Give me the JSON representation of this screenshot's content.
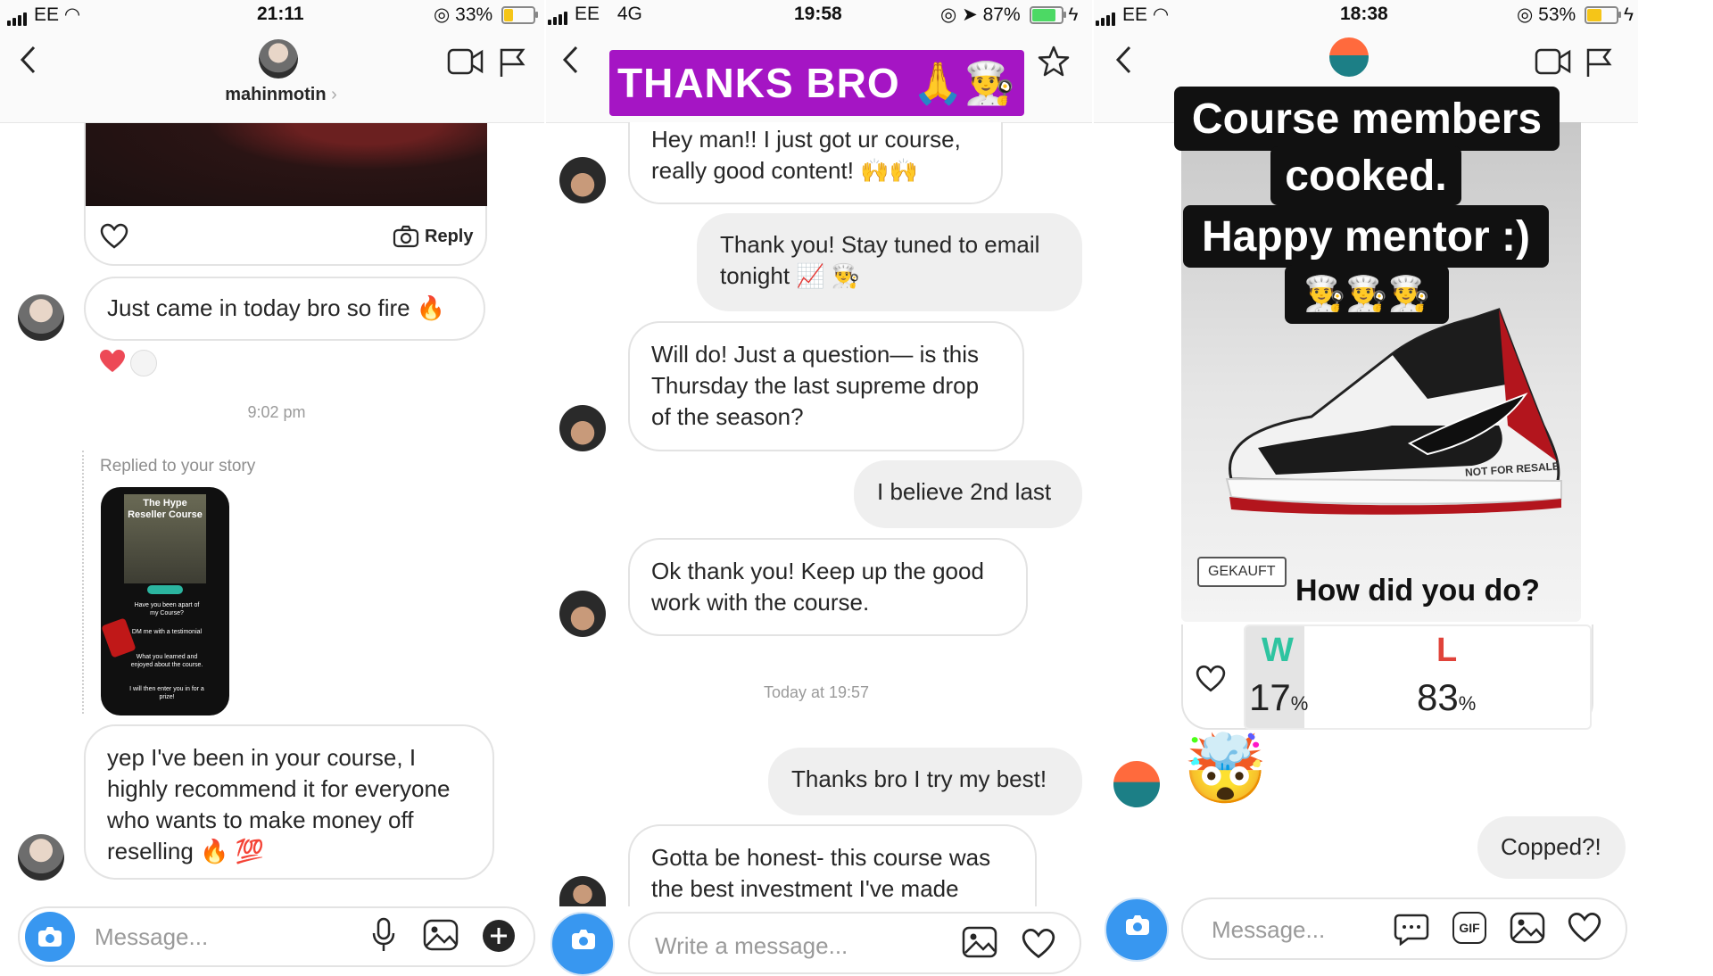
{
  "panel1": {
    "status": {
      "carrier": "EE",
      "time": "21:11",
      "battery": "33%"
    },
    "username": "mahinmotin",
    "story_reply_label": "Reply",
    "msg1": "Just came in today bro so fire 🔥",
    "timestamp": "9:02 pm",
    "replied_label": "Replied to your story",
    "story_thumb": {
      "title": "The Hype Reseller Course",
      "line1": "Have you been apart of my Course?",
      "line2": "DM me with a testimonial",
      "line3": "What you learned and enjoyed about the course.",
      "line4": "I will then enter you in for a prize!"
    },
    "msg2": "yep I've been in your course, I highly recommend it for everyone who wants to make money off reselling 🔥 💯",
    "placeholder": "Message..."
  },
  "panel2": {
    "status": {
      "carrier": "EE",
      "network": "4G",
      "time": "19:58",
      "battery": "87%"
    },
    "banner": "THANKS BRO 🙏👨‍🍳",
    "msg1": "Hey man!! I just got ur course, really good content! 🙌🙌",
    "reply1": "Thank you! Stay tuned to email tonight 📈 👨‍🍳",
    "msg2": "Will do! Just a question— is this Thursday the last supreme drop of the season?",
    "reply2": "I believe 2nd last",
    "msg3": "Ok thank you! Keep up the good work with the course.",
    "timestamp": "Today at 19:57",
    "reply3": "Thanks bro I try my best!",
    "msg4": "Gotta be honest- this course was the best investment I've made",
    "placeholder": "Write a message..."
  },
  "panel3": {
    "status": {
      "carrier": "EE",
      "time": "18:38",
      "battery": "53%"
    },
    "caption_line1": "Course members",
    "caption_line2": "cooked.",
    "caption_line3": "Happy mentor :)",
    "caption_emojis": "👨‍🍳👨‍🍳👨‍🍳",
    "shoe_tag": "NOT FOR RESALE",
    "gekauft": "GEKAUFT",
    "poll_question": "How did you do?",
    "poll": {
      "w_label": "W",
      "w_value": "17",
      "l_label": "L",
      "l_value": "83",
      "pct": "%"
    },
    "reaction": "🤯",
    "reply": "Copped?!",
    "placeholder": "Message...",
    "gif_label": "GIF"
  },
  "colors": {
    "accent_blue": "#3897f0",
    "banner_purple": "#a515c4",
    "poll_green": "#2ec4a0",
    "poll_red": "#e0433a",
    "heart_red": "#ed4956"
  }
}
